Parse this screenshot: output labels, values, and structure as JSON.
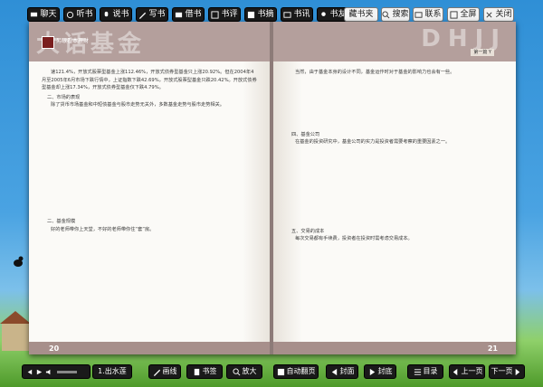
{
  "top_toolbar": {
    "left_buttons": [
      "聊天",
      "听书",
      "说书",
      "写书",
      "借书",
      "书评",
      "书摘",
      "书讯",
      "书友"
    ],
    "right_buttons": [
      "藏书夹",
      "搜索",
      "联系",
      "全屏",
      "关闭"
    ]
  },
  "left_page": {
    "header_bg_text": "大话基金",
    "series_logo_text": "另眼看本理财",
    "paragraphs": [
      "速121.4%，开放式股票型基金上涨112.46%，开放式债券型基金只上涨20.92%。但在2004年4月至2005年6月市场下跌行情中，上证指数下跌42.69%，开放式股票型基金只跌20.42%。开放式债券型基金却上涨17.34%，开放式债券型基金仅下跌4.79%。",
      "二、市场的表现",
      "除了货币市场基金和中短债基金与股市走势无关外，多数基金走势与股市走势相关。",
      "二、基金规模",
      "好的老师带你上天堂，不好的老师带你住“套”房。"
    ],
    "page_number": "20"
  },
  "right_page": {
    "header_bg_text": "DHJJ",
    "chapter_tag": "第一篇 Y",
    "paragraphs": [
      "当然，由于基金本身的设计不同，基金运作时对于基金的影响力也会有一些。",
      "四、基金公司",
      "在基金的投资研究中，基金公司的实力是投资者需要考察的重要因素之一。",
      "五、交易的成本",
      "每次交易都有手续费，投资者在投资时需考虑交易成本。"
    ],
    "page_number": "21"
  },
  "bottom_toolbar": {
    "track_label": "1.出水莲",
    "buttons": [
      "画线",
      "书签",
      "放大",
      "自动翻页",
      "封面",
      "封底",
      "目录",
      "上一页",
      "下一页"
    ]
  }
}
